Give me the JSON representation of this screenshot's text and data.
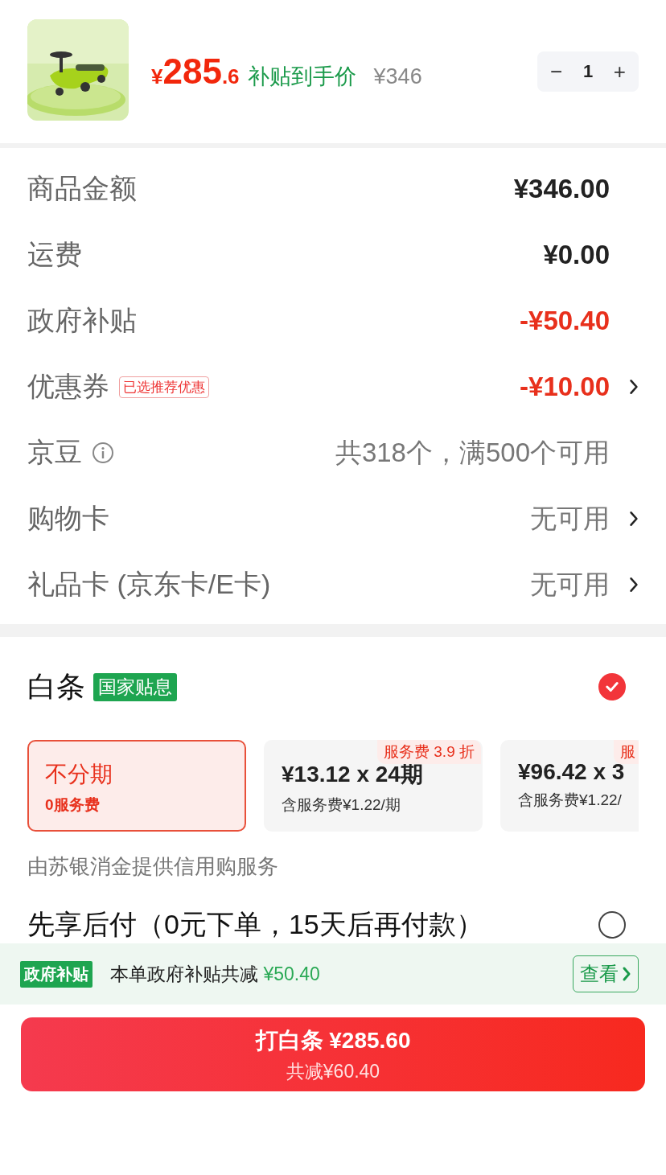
{
  "product": {
    "price_symbol": "¥",
    "price_int": "285",
    "price_dec": ".6",
    "price_label": "补贴到手价",
    "original_price": "¥346",
    "quantity": "1",
    "minus": "−",
    "plus": "+"
  },
  "summary": [
    {
      "label": "商品金额",
      "value": "¥346.00",
      "kind": "amount",
      "arrow": false
    },
    {
      "label": "运费",
      "value": "¥0.00",
      "kind": "amount",
      "arrow": false
    },
    {
      "label": "政府补贴",
      "value": "-¥50.40",
      "kind": "discount",
      "arrow": false
    },
    {
      "label": "优惠券",
      "tag": "已选推荐优惠",
      "value": "-¥10.00",
      "kind": "discount",
      "arrow": true
    },
    {
      "label": "京豆",
      "info": true,
      "value": "共318个，满500个可用",
      "kind": "note",
      "arrow": false
    },
    {
      "label": "购物卡",
      "value": "无可用",
      "kind": "note",
      "arrow": true
    },
    {
      "label": "礼品卡 (京东卡/E卡)",
      "value": "无可用",
      "kind": "note",
      "arrow": true
    }
  ],
  "baitiao": {
    "title": "白条",
    "badge": "国家贴息",
    "checked": true,
    "options": [
      {
        "title": "不分期",
        "subtitle": "0服务费",
        "selected": true
      },
      {
        "title": "¥13.12 x 24期",
        "subtitle": "含服务费¥1.22/期",
        "badge": "服务费 3.9 折",
        "selected": false
      },
      {
        "title": "¥96.42 x 3",
        "subtitle": "含服务费¥1.22/",
        "badge": "服",
        "selected": false
      }
    ],
    "provider": "由苏银消金提供信用购服务"
  },
  "pay_later": {
    "title": "先享后付（0元下单，15天后再付款）",
    "checked": false
  },
  "subsidy_bar": {
    "tag": "政府补贴",
    "text": "本单政府补贴共减",
    "amount": "¥50.40",
    "button": "查看"
  },
  "pay_button": {
    "title": "打白条 ¥285.60",
    "subtitle": "共减¥60.40"
  }
}
